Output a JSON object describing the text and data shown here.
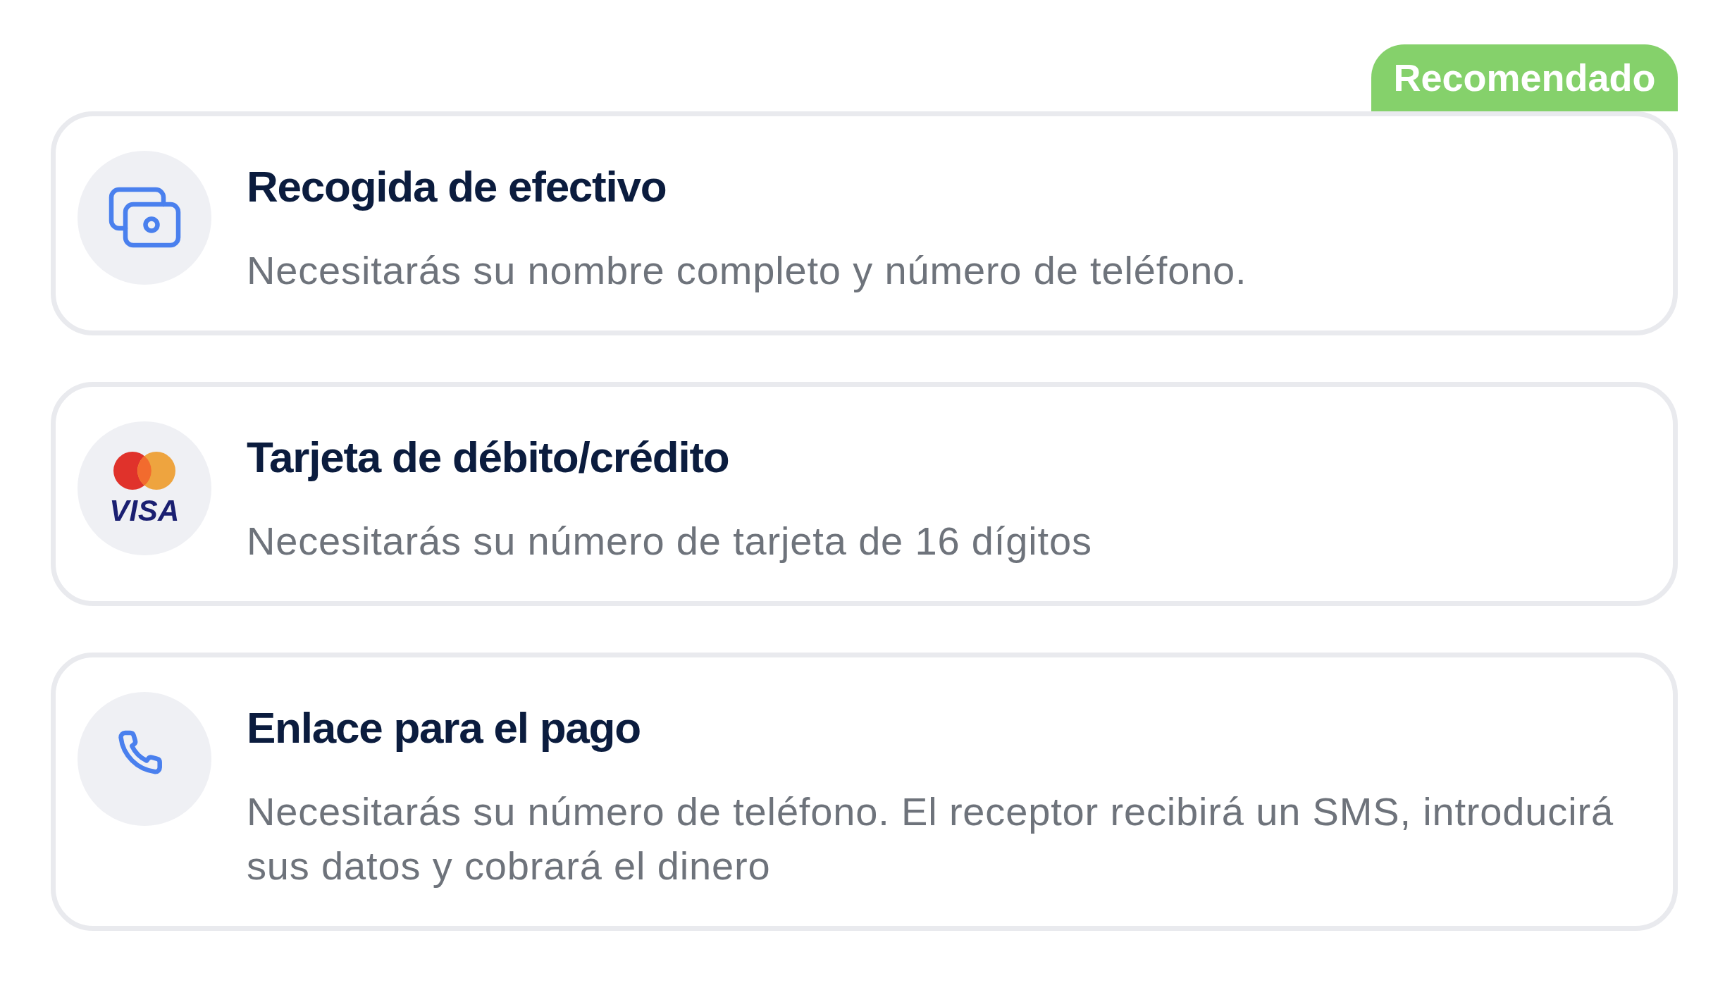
{
  "options": [
    {
      "kind": "cash",
      "badge": "Recomendado",
      "title": "Recogida de efectivo",
      "description": "Necesitarás su nombre completo y número de teléfono."
    },
    {
      "kind": "card",
      "logo_text": "VISA",
      "title": "Tarjeta de débito/crédito",
      "description": "Necesitarás su número de tarjeta de 16 dígitos"
    },
    {
      "kind": "payment_link",
      "title": "Enlace para el pago",
      "description": "Necesitarás su número de teléfono. El receptor recibirá un SMS, introducirá sus datos y cobrará el dinero"
    }
  ]
}
